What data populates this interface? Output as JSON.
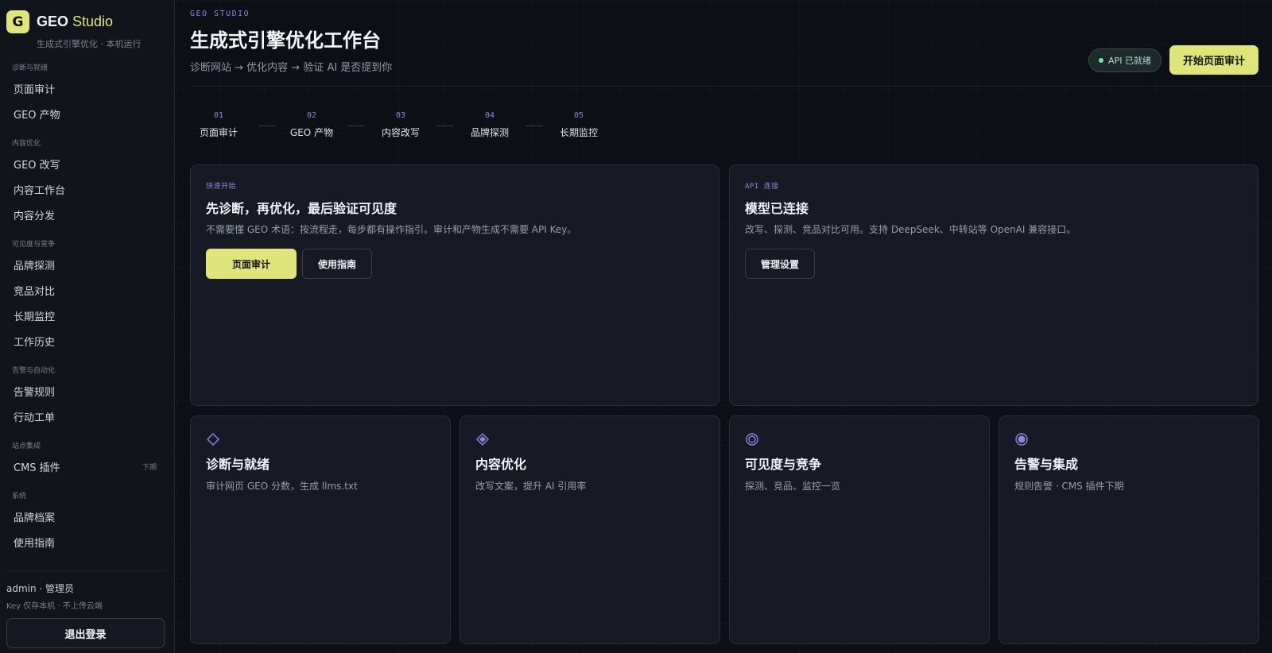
{
  "brand": {
    "logo_letter": "G",
    "name_main": "GEO",
    "name_accent": "Studio",
    "subtitle": "生成式引擎优化 · 本机运行"
  },
  "sidebar": {
    "groups": [
      {
        "label": "诊断与就绪",
        "items": [
          {
            "label": "页面审计"
          },
          {
            "label": "GEO 产物"
          }
        ]
      },
      {
        "label": "内容优化",
        "items": [
          {
            "label": "GEO 改写"
          },
          {
            "label": "内容工作台"
          },
          {
            "label": "内容分发"
          }
        ]
      },
      {
        "label": "可见度与竞争",
        "items": [
          {
            "label": "品牌探测"
          },
          {
            "label": "竞品对比"
          },
          {
            "label": "长期监控"
          },
          {
            "label": "工作历史"
          }
        ]
      },
      {
        "label": "告警与自动化",
        "items": [
          {
            "label": "告警规则"
          },
          {
            "label": "行动工单"
          }
        ]
      },
      {
        "label": "站点集成",
        "items": [
          {
            "label": "CMS 插件",
            "tag": "下期"
          }
        ]
      },
      {
        "label": "系统",
        "items": [
          {
            "label": "品牌档案"
          },
          {
            "label": "使用指南"
          }
        ]
      }
    ],
    "user": "admin · 管理员",
    "key_note": "Key  仅存本机  ·  不上传云端",
    "logout_label": "退出登录"
  },
  "header": {
    "eyebrow": "GEO STUDIO",
    "title": "生成式引擎优化工作台",
    "subtitle": "诊断网站 → 优化内容 → 验证 AI 是否提到你",
    "api_status": "API 已就绪",
    "start_button": "开始页面审计"
  },
  "steps": [
    {
      "num": "01",
      "label": "页面审计"
    },
    {
      "num": "02",
      "label": "GEO 产物"
    },
    {
      "num": "03",
      "label": "内容改写"
    },
    {
      "num": "04",
      "label": "品牌探测"
    },
    {
      "num": "05",
      "label": "长期监控"
    }
  ],
  "quickstart": {
    "kicker": "快速开始",
    "title": "先诊断，再优化，最后验证可见度",
    "desc": "不需要懂 GEO 术语：按流程走，每步都有操作指引。审计和产物生成不需要 API Key。",
    "primary_button": "页面审计",
    "secondary_button": "使用指南"
  },
  "api_card": {
    "kicker": "API 连接",
    "title": "模型已连接",
    "desc": "改写、探测、竞品对比可用。支持 DeepSeek、中转站等 OpenAI 兼容接口。",
    "button": "管理设置"
  },
  "modules": [
    {
      "icon": "diamond-outline-icon",
      "title": "诊断与就绪",
      "desc": "审计网页 GEO 分数，生成 llms.txt"
    },
    {
      "icon": "diamond-filled-icon",
      "title": "内容优化",
      "desc": "改写文案，提升 AI 引用率"
    },
    {
      "icon": "target-ring-icon",
      "title": "可见度与竞争",
      "desc": "探测、竞品、监控一览"
    },
    {
      "icon": "radio-dot-icon",
      "title": "告警与集成",
      "desc": "规则告警 · CMS 插件下期"
    }
  ],
  "colors": {
    "accent": "#dfe57a",
    "kicker": "#8f86e0",
    "background": "#0d0f16",
    "card": "#171a24",
    "status_dot": "#7fe0a8"
  }
}
